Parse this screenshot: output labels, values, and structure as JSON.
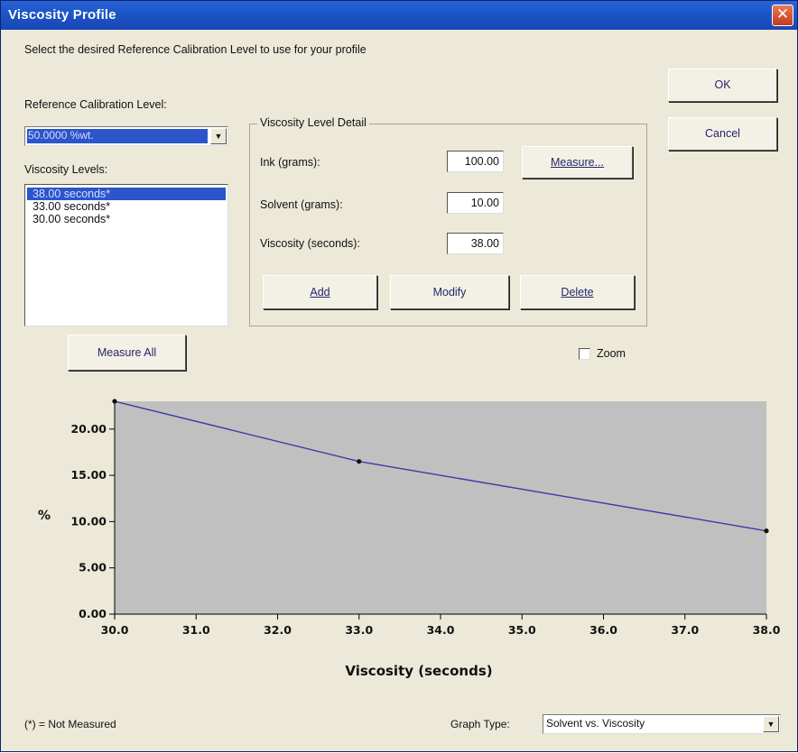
{
  "window": {
    "title": "Viscosity Profile",
    "close_glyph": "✕"
  },
  "instructions": "Select the desired Reference Calibration Level to use for your profile",
  "reference_calibration": {
    "label": "Reference Calibration Level:",
    "selected": "50.0000 %wt."
  },
  "viscosity_levels": {
    "label": "Viscosity Levels:",
    "items": [
      "38.00 seconds*",
      "33.00 seconds*",
      "30.00 seconds*"
    ]
  },
  "detail": {
    "legend": "Viscosity Level Detail",
    "ink_label": "Ink (grams):",
    "ink_value": "100.00",
    "solvent_label": "Solvent (grams):",
    "solvent_value": "10.00",
    "viscosity_label": "Viscosity (seconds):",
    "viscosity_value": "38.00",
    "measure_label": "Measure...",
    "add_label": "Add",
    "modify_label": "Modify",
    "delete_label": "Delete"
  },
  "buttons": {
    "ok": "OK",
    "cancel": "Cancel",
    "measure_all": "Measure All"
  },
  "zoom": {
    "label": "Zoom",
    "checked": false
  },
  "footnote": "(*) = Not Measured",
  "graph_type": {
    "label": "Graph Type:",
    "selected": "Solvent vs. Viscosity"
  },
  "colors": {
    "plot_bg": "#c0c0c0",
    "line": "#3a3aa8",
    "selection": "#2b55c9"
  },
  "chart_data": {
    "type": "line",
    "x": [
      30.0,
      33.0,
      38.0
    ],
    "y": [
      23.0,
      16.5,
      9.0
    ],
    "xlabel": "Viscosity (seconds)",
    "ylabel": "%",
    "xlim": [
      30.0,
      38.0
    ],
    "ylim": [
      0.0,
      23.0
    ],
    "xticks": [
      "30.0",
      "31.0",
      "32.0",
      "33.0",
      "34.0",
      "35.0",
      "36.0",
      "37.0",
      "38.0"
    ],
    "yticks": [
      "0.00",
      "5.00",
      "10.00",
      "15.00",
      "20.00"
    ],
    "grid": false
  }
}
